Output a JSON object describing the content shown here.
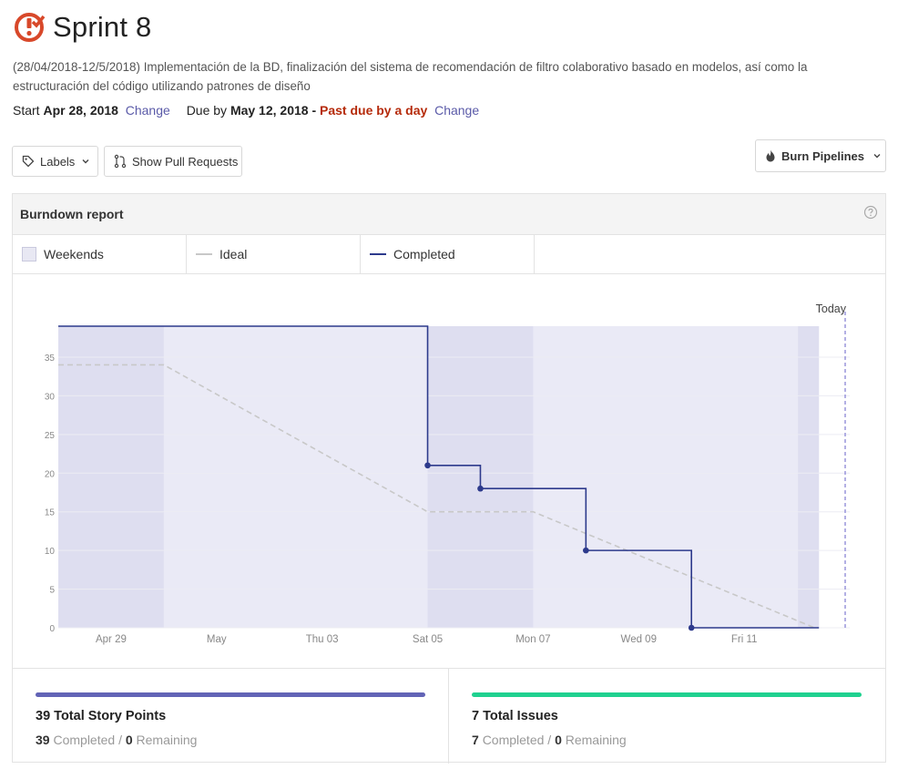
{
  "milestone": {
    "title": "Sprint 8",
    "description": "(28/04/2018-12/5/2018) Implementación de la BD, finalización del sistema de recomendación de filtro colaborativo basado en modelos, así como la estructuración del código utilizando patrones de diseño",
    "start_label": "Start",
    "start_date": "Apr 28, 2018",
    "change_label": "Change",
    "due_label": "Due by",
    "due_date": "May 12, 2018",
    "due_separator": "-",
    "past_due": "Past due by a day"
  },
  "toolbar": {
    "labels_button": "Labels",
    "pull_requests_button": "Show Pull Requests",
    "burn_pipelines_button": "Burn Pipelines"
  },
  "report": {
    "title": "Burndown report",
    "legend": [
      "Weekends",
      "Ideal",
      "Completed"
    ]
  },
  "chart_data": {
    "type": "line",
    "x_ticks": [
      "Apr 29",
      "May",
      "Thu 03",
      "Sat 05",
      "Mon 07",
      "Wed 09",
      "Fri 11"
    ],
    "y_ticks": [
      0,
      5,
      10,
      15,
      20,
      25,
      30,
      35
    ],
    "ylim": [
      0,
      39
    ],
    "xlim": [
      "2018-04-28",
      "2018-05-13"
    ],
    "weekends": [
      [
        "2018-04-28",
        "2018-04-30"
      ],
      [
        "2018-05-05",
        "2018-05-07"
      ],
      [
        "2018-05-12",
        "2018-05-12T10:00"
      ]
    ],
    "today_label": "Today",
    "today": "2018-05-13",
    "series": [
      {
        "name": "Ideal",
        "style": "dashed",
        "color": "#c8c8c8",
        "x": [
          "2018-04-28",
          "2018-04-30",
          "2018-05-05",
          "2018-05-07",
          "2018-05-12T08:00"
        ],
        "y": [
          34,
          34,
          15,
          15,
          0
        ]
      },
      {
        "name": "Completed",
        "style": "step",
        "color": "#2d3a8c",
        "x": [
          "2018-04-28",
          "2018-05-05",
          "2018-05-06",
          "2018-05-08",
          "2018-05-10",
          "2018-05-12T10:00"
        ],
        "y": [
          39,
          21,
          18,
          10,
          0,
          0
        ],
        "markers": [
          false,
          true,
          true,
          true,
          true,
          false
        ]
      }
    ],
    "colors": {
      "band": "#eaeaf6",
      "weekend": "#dedef0",
      "grid": "#ececf3",
      "today": "#8a86d6"
    }
  },
  "summary": {
    "story_points": {
      "title": "39 Total Story Points",
      "completed": "39",
      "completed_label": "Completed",
      "separator": "/",
      "remaining": "0",
      "remaining_label": "Remaining",
      "bar_color": "#6264b6"
    },
    "issues": {
      "title": "7 Total Issues",
      "completed": "7",
      "completed_label": "Completed",
      "separator": "/",
      "remaining": "0",
      "remaining_label": "Remaining",
      "bar_color": "#1fd18f"
    }
  }
}
